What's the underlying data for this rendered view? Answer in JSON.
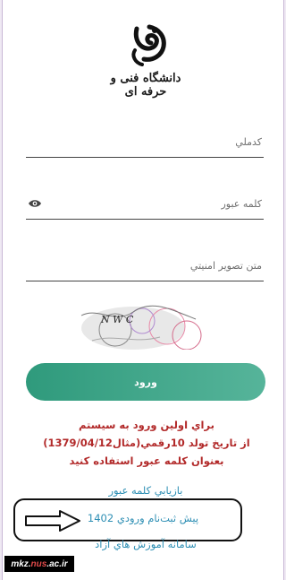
{
  "logo": {
    "text": "دانشگاه فنی و حرفه ای"
  },
  "form": {
    "username_placeholder": "كدملي",
    "password_placeholder": "كلمه عبور",
    "captcha_placeholder": "متن تصوير امنيتي",
    "captcha_text": "N W C",
    "login_label": "ورود"
  },
  "notice": {
    "line1": "براي اولين ورود به سيستم",
    "line2": "از تاريخ تولد 10رقمي(مثال1379/04/12)",
    "line3": "بعنوان كلمه عبور استفاده كنيد"
  },
  "links": {
    "password_recovery": "بازيابي كلمه عبور",
    "pre_registration": "پيش ثبت‌نام ورودي 1402",
    "free_education": "سامانه آموزش هاي آزاد"
  },
  "watermark": {
    "prefix": "mkz.",
    "accent": "nus",
    "suffix": ".ac.ir"
  },
  "colors": {
    "button": "#3fa688",
    "notice": "#b22a2a",
    "link": "#2e8fb4"
  }
}
